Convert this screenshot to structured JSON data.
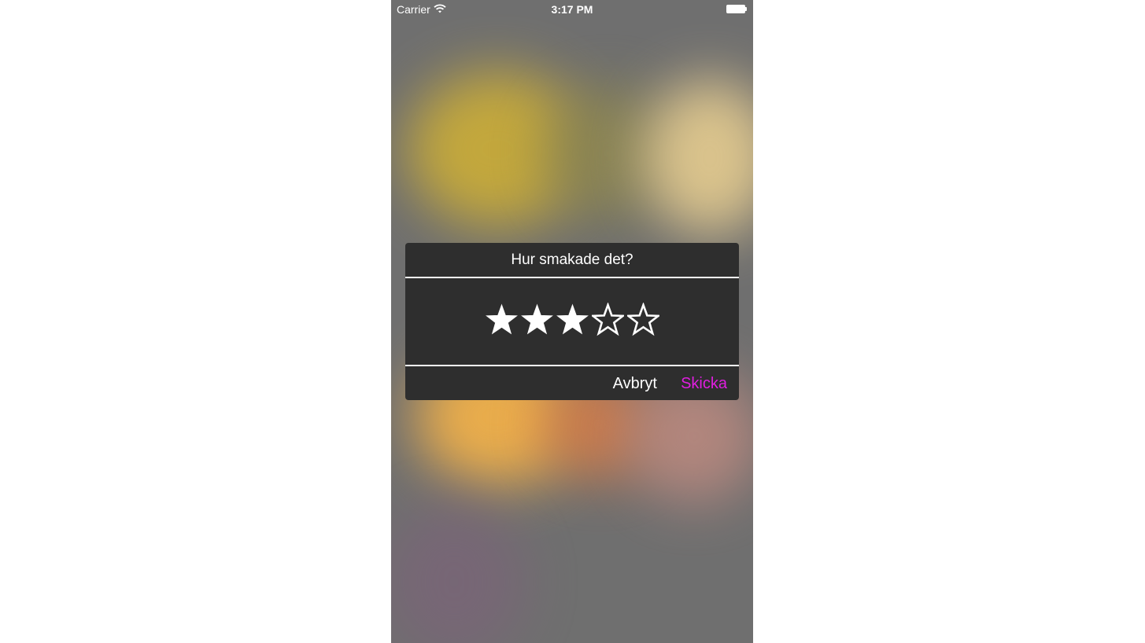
{
  "status_bar": {
    "carrier": "Carrier",
    "time": "3:17 PM",
    "wifi_icon": "wifi-icon",
    "battery_icon": "battery-icon"
  },
  "dialog": {
    "title": "Hur smakade det?",
    "rating": {
      "value": 3,
      "max": 5,
      "filled_icon": "star-filled-icon",
      "empty_icon": "star-outline-icon"
    },
    "cancel_label": "Avbryt",
    "submit_label": "Skicka"
  },
  "colors": {
    "dialog_background": "#2e2e2e",
    "text": "#ffffff",
    "accent": "#e01ee0",
    "backdrop": "#6f6f6f"
  }
}
